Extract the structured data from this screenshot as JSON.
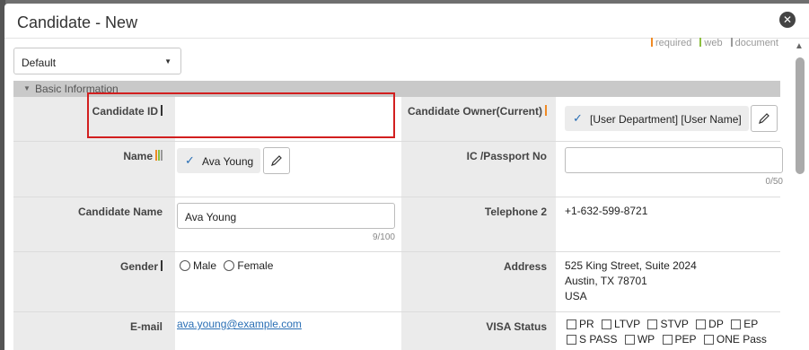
{
  "dialog": {
    "title": "Candidate - New",
    "close_icon": "x-circle-icon"
  },
  "legend": {
    "required": "required",
    "web": "web",
    "document": "document",
    "colors": {
      "required": "#f08a24",
      "web": "#8cbf3f",
      "document": "#9a9a9a"
    }
  },
  "view_select": {
    "value": "Default"
  },
  "section": {
    "title": "Basic Information"
  },
  "fields": {
    "candidate_id": {
      "label": "Candidate ID",
      "value": ""
    },
    "candidate_owner": {
      "label": "Candidate Owner(Current)",
      "chip": "[User Department] [User Name]"
    },
    "name": {
      "label": "Name",
      "chip": "Ava Young"
    },
    "ic_passport": {
      "label": "IC /Passport No",
      "value": "",
      "counter": "0/50"
    },
    "candidate_name": {
      "label": "Candidate Name",
      "value": "Ava Young",
      "counter": "9/100"
    },
    "telephone2": {
      "label": "Telephone 2",
      "value": "+1-632-599-8721"
    },
    "gender": {
      "label": "Gender",
      "options": [
        "Male",
        "Female"
      ]
    },
    "address": {
      "label": "Address",
      "lines": [
        "525 King Street, Suite 2024",
        "Austin, TX 78701",
        "USA"
      ]
    },
    "email": {
      "label": "E-mail",
      "value": "ava.young@example.com"
    },
    "visa_status": {
      "label": "VISA Status",
      "options": [
        "PR",
        "LTVP",
        "STVP",
        "DP",
        "EP",
        "S PASS",
        "WP",
        "PEP",
        "ONE Pass"
      ]
    }
  },
  "highlight_color": "#d21f1f"
}
